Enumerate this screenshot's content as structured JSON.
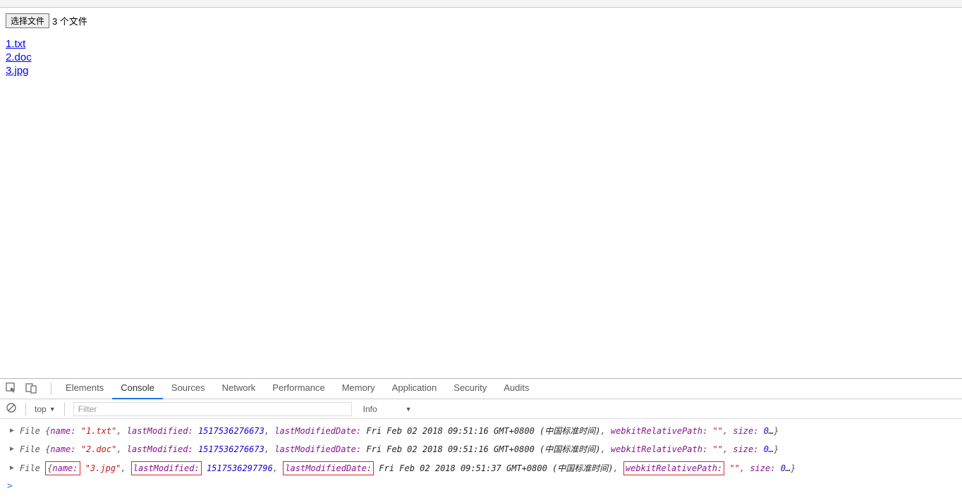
{
  "page": {
    "choose_file_label": "选择文件",
    "file_status": "3 个文件",
    "file_links": [
      "1.txt",
      "2.doc",
      "3.jpg"
    ]
  },
  "devtools": {
    "tabs": [
      "Elements",
      "Console",
      "Sources",
      "Network",
      "Performance",
      "Memory",
      "Application",
      "Security",
      "Audits"
    ],
    "active_tab": "Console",
    "scope": "top",
    "filter_placeholder": "Filter",
    "level_label": "Info",
    "console_entries": [
      {
        "type": "File",
        "name": "1.txt",
        "lastModified": "1517536276673",
        "dateText": "Fri Feb 02 2018 09:51:16 GMT+0800 (中国标准时间)",
        "relPath": "\"\"",
        "sizePrefix": "0",
        "boxed": false
      },
      {
        "type": "File",
        "name": "2.doc",
        "lastModified": "1517536276673",
        "dateText": "Fri Feb 02 2018 09:51:16 GMT+0800 (中国标准时间)",
        "relPath": "\"\"",
        "sizePrefix": "0",
        "boxed": false
      },
      {
        "type": "File",
        "name": "3.jpg",
        "lastModified": "1517536297796",
        "dateText": "Fri Feb 02 2018 09:51:37 GMT+0800 (中国标准时间)",
        "relPath": "\"\"",
        "sizePrefix": "0",
        "boxed": true
      }
    ],
    "prompt": ">"
  },
  "labels": {
    "name_key": "name:",
    "lastModified_key": "lastModified:",
    "lastModifiedDate_key": "lastModifiedDate:",
    "webkitRelativePath_key": "webkitRelativePath:",
    "size_key": "size:",
    "ellipsis": "…"
  }
}
